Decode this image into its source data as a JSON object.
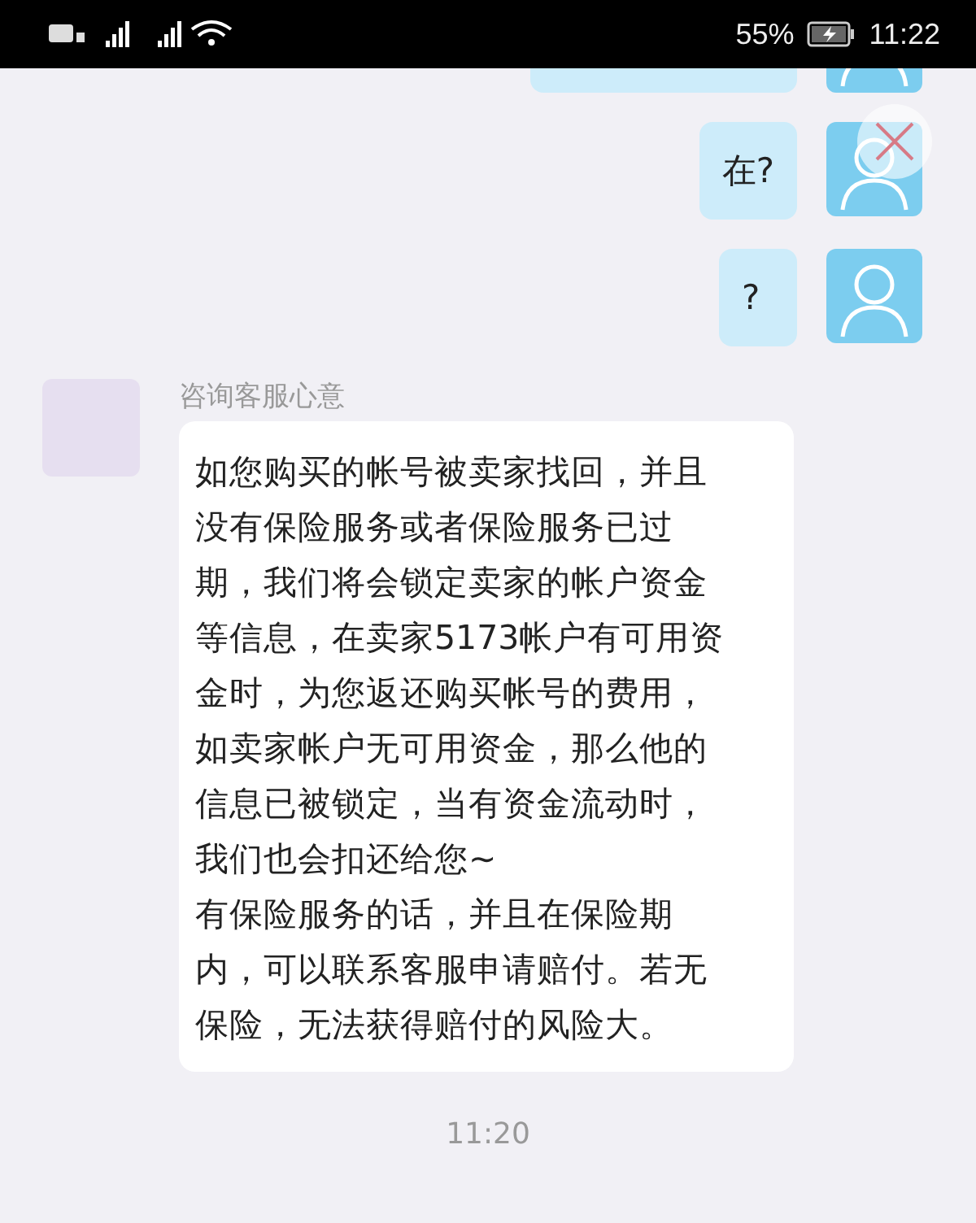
{
  "status_bar": {
    "battery": "55%",
    "time": "11:22"
  },
  "messages": [
    {
      "kind": "outgoing-cut"
    },
    {
      "kind": "outgoing",
      "lines": [
        "在?"
      ]
    },
    {
      "kind": "outgoing",
      "lines": [
        "?"
      ]
    },
    {
      "kind": "incoming",
      "sender": "咨询客服心意",
      "lines": [
        "如您购买的帐号被卖家找回，并且",
        "没有保险服务或者保险服务已过",
        "期，我们将会锁定卖家的帐户资金",
        "等信息，在卖家5173帐户有可用资",
        "金时，为您返还购买帐号的费用，",
        "如卖家帐户无可用资金，那么他的",
        "信息已被锁定，当有资金流动时，",
        "我们也会扣还给您~",
        "有保险服务的话，并且在保险期",
        "内，可以联系客服申请赔付。若无",
        "保险，无法获得赔付的风险大。"
      ]
    }
  ],
  "timestamp": "11:20"
}
